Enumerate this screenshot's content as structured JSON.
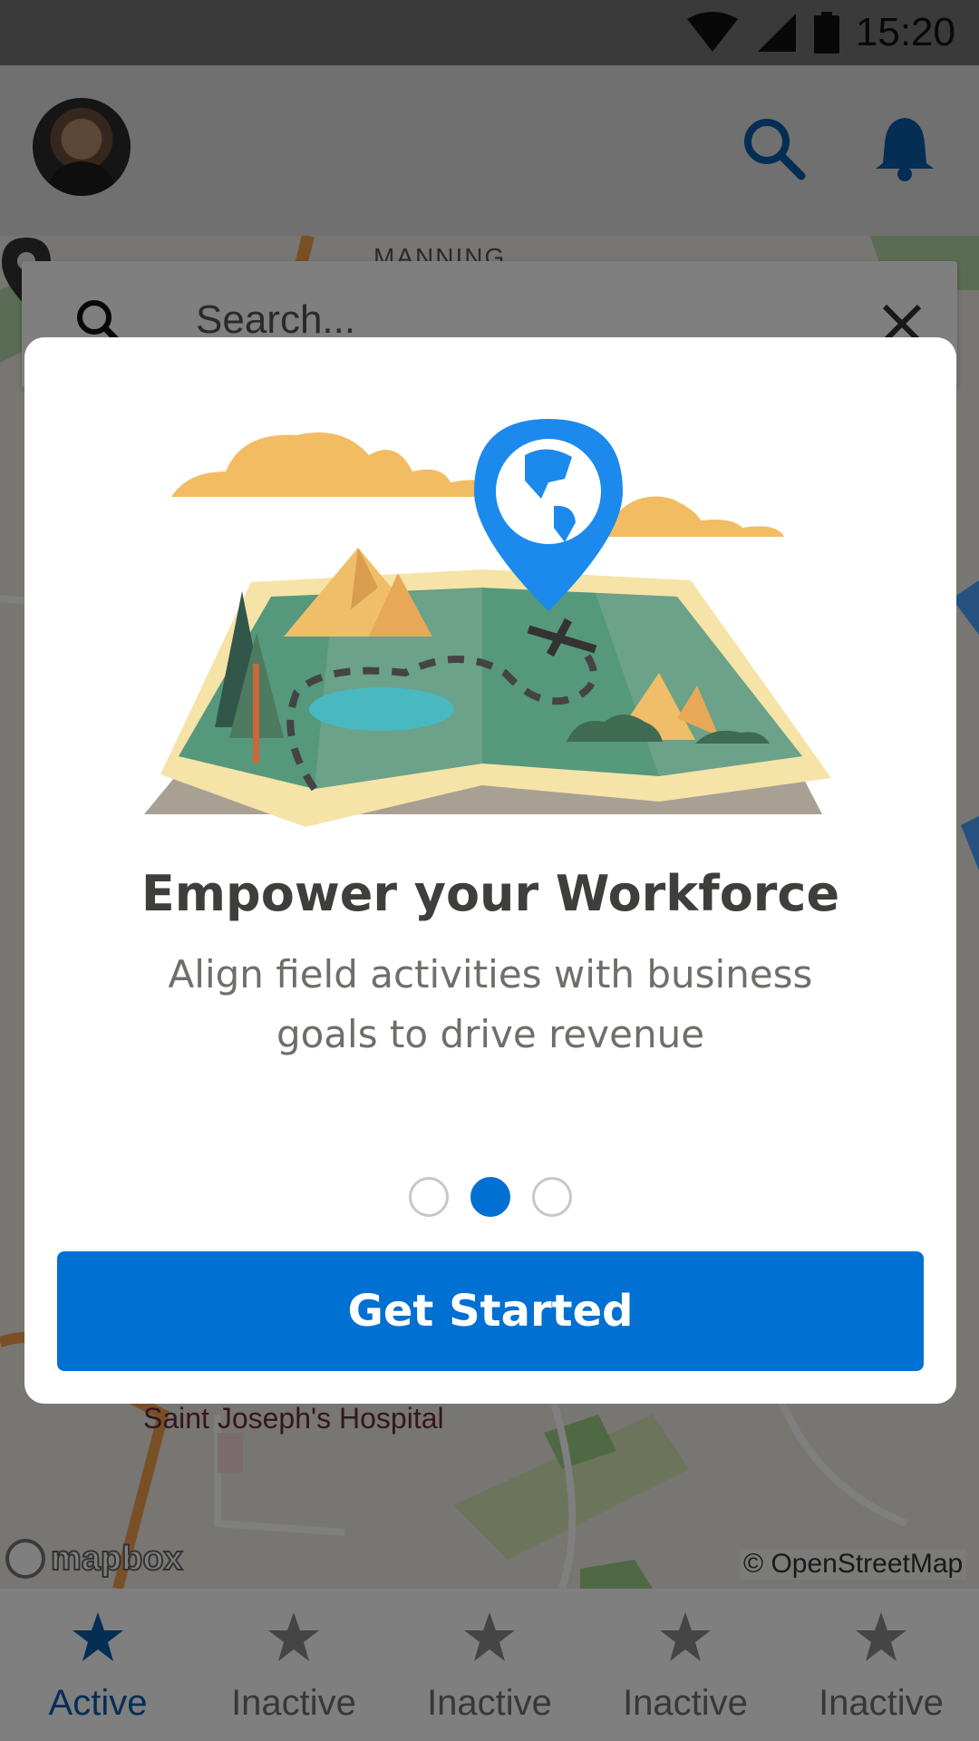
{
  "status_bar": {
    "time": "15:20",
    "icons": [
      "wifi-icon",
      "cell-signal-icon",
      "battery-icon"
    ]
  },
  "header": {
    "icons": [
      "avatar",
      "search-icon",
      "bell-icon"
    ]
  },
  "map": {
    "top_label": "MANNING",
    "hospital_label": "Saint Joseph's Hospital",
    "attribution": "© OpenStreetMap",
    "logo_text": "mapbox"
  },
  "map_search": {
    "placeholder": "Search..."
  },
  "modal": {
    "title": "Empower your Workforce",
    "subtitle": "Align field activities with business goals to drive revenue",
    "pagination": {
      "count": 3,
      "active_index": 1
    },
    "cta_label": "Get Started"
  },
  "bottom_nav": {
    "items": [
      {
        "label": "Active",
        "icon": "star-icon",
        "active": true
      },
      {
        "label": "Inactive",
        "icon": "star-icon",
        "active": false
      },
      {
        "label": "Inactive",
        "icon": "star-icon",
        "active": false
      },
      {
        "label": "Inactive",
        "icon": "star-icon",
        "active": false
      },
      {
        "label": "Inactive",
        "icon": "star-icon",
        "active": false
      }
    ]
  },
  "colors": {
    "brand_blue": "#0070d2",
    "nav_active": "#0b5cab",
    "title": "#3e3e3c",
    "subtitle": "#706e6b"
  }
}
